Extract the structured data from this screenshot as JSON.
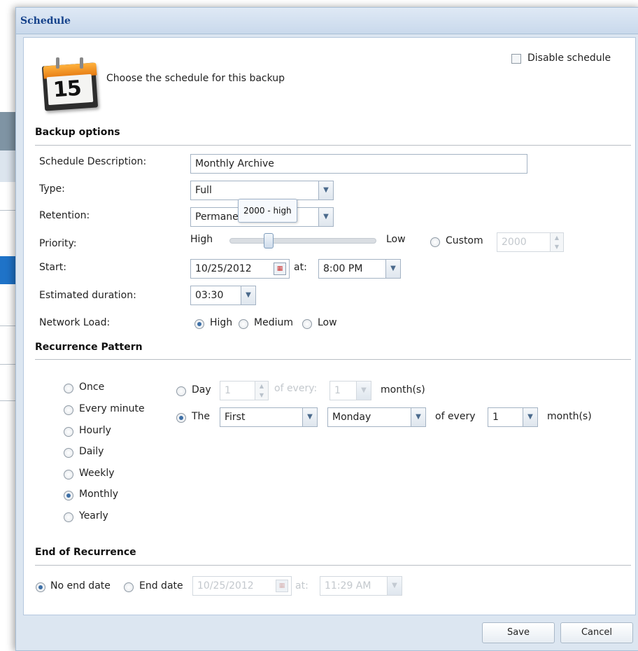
{
  "dialog": {
    "title": "Schedule",
    "header_text": "Choose the schedule for this backup",
    "calendar_icon_day": "15",
    "disable_schedule_label": "Disable schedule"
  },
  "backup_options": {
    "section_title": "Backup options",
    "description_label": "Schedule Description:",
    "description_value": "Monthly Archive",
    "type_label": "Type:",
    "type_value": "Full",
    "retention_label": "Retention:",
    "retention_value": "Permanent",
    "retention_visible_text": "Permane",
    "priority_label": "Priority:",
    "priority_high": "High",
    "priority_low": "Low",
    "priority_tooltip": "2000 - high",
    "custom_label": "Custom",
    "custom_value": "2000",
    "start_label": "Start:",
    "start_date": "10/25/2012",
    "at_label": "at:",
    "start_time": "8:00 PM",
    "duration_label": "Estimated duration:",
    "duration_value": "03:30",
    "network_label": "Network Load:",
    "network_options": [
      "High",
      "Medium",
      "Low"
    ],
    "network_selected": "High"
  },
  "recurrence": {
    "section_title": "Recurrence Pattern",
    "patterns": [
      "Once",
      "Every minute",
      "Hourly",
      "Daily",
      "Weekly",
      "Monthly",
      "Yearly"
    ],
    "selected_pattern": "Monthly",
    "day_label": "Day",
    "day_value": "1",
    "of_every_label": "of every:",
    "of_every_value": "1",
    "months_label": "month(s)",
    "the_label": "The",
    "ordinal_value": "First",
    "weekday_value": "Monday",
    "the_of_every_label": "of every",
    "the_of_every_value": "1",
    "the_months_label": "month(s)"
  },
  "end_of_recurrence": {
    "section_title": "End of Recurrence",
    "no_end_label": "No end date",
    "end_date_label": "End date",
    "end_date_value": "10/25/2012",
    "at_label": "at:",
    "end_time_value": "11:29 AM"
  },
  "footer": {
    "save_label": "Save",
    "cancel_label": "Cancel"
  }
}
